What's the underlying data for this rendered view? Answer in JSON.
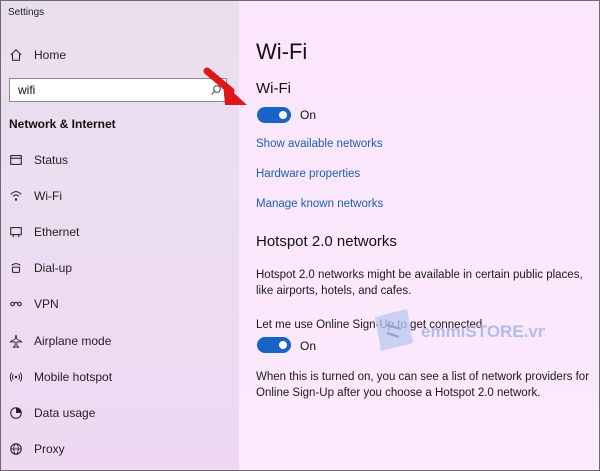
{
  "window": {
    "title": "Settings"
  },
  "sidebar": {
    "home_label": "Home",
    "search": {
      "value": "wifi",
      "placeholder": ""
    },
    "section_title": "Network & Internet",
    "items": [
      {
        "label": "Status",
        "icon": "status-icon"
      },
      {
        "label": "Wi-Fi",
        "icon": "wifi-icon"
      },
      {
        "label": "Ethernet",
        "icon": "ethernet-icon"
      },
      {
        "label": "Dial-up",
        "icon": "dialup-icon"
      },
      {
        "label": "VPN",
        "icon": "vpn-icon"
      },
      {
        "label": "Airplane mode",
        "icon": "airplane-icon"
      },
      {
        "label": "Mobile hotspot",
        "icon": "hotspot-icon"
      },
      {
        "label": "Data usage",
        "icon": "data-usage-icon"
      },
      {
        "label": "Proxy",
        "icon": "globe-icon"
      }
    ]
  },
  "main": {
    "title": "Wi-Fi",
    "wifi_section": {
      "heading": "Wi-Fi",
      "toggle_state": "On",
      "links": [
        "Show available networks",
        "Hardware properties",
        "Manage known networks"
      ]
    },
    "hotspot_section": {
      "heading": "Hotspot 2.0 networks",
      "description_line1": "Hotspot 2.0 networks might be available in certain public places,",
      "description_line2": "like airports, hotels, and cafes.",
      "signup_label": "Let me use Online Sign-Up to get connected",
      "toggle_state": "On",
      "note_line1": "When this is turned on, you can see a list of network providers for",
      "note_line2": "Online Sign-Up after you choose a Hotspot 2.0 network."
    }
  },
  "watermark": {
    "brand": "emmiSTORE.vn"
  },
  "colors": {
    "accent": "#1a63c6",
    "link": "#1b5fb5",
    "arrow": "#e0161d"
  }
}
